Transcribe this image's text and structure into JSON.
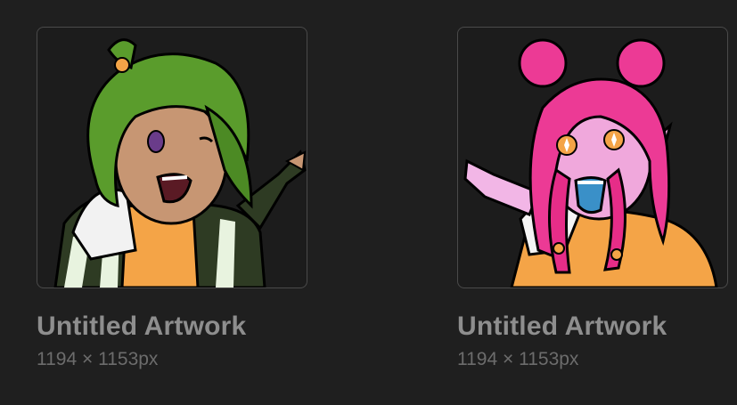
{
  "gallery": {
    "artworks": [
      {
        "title": "Untitled Artwork",
        "dimensions": "1194 × 1153px",
        "thumbnail": "green-haired-character-pointing"
      },
      {
        "title": "Untitled Artwork",
        "dimensions": "1194 × 1153px",
        "thumbnail": "pink-haired-character-pointing"
      }
    ]
  }
}
